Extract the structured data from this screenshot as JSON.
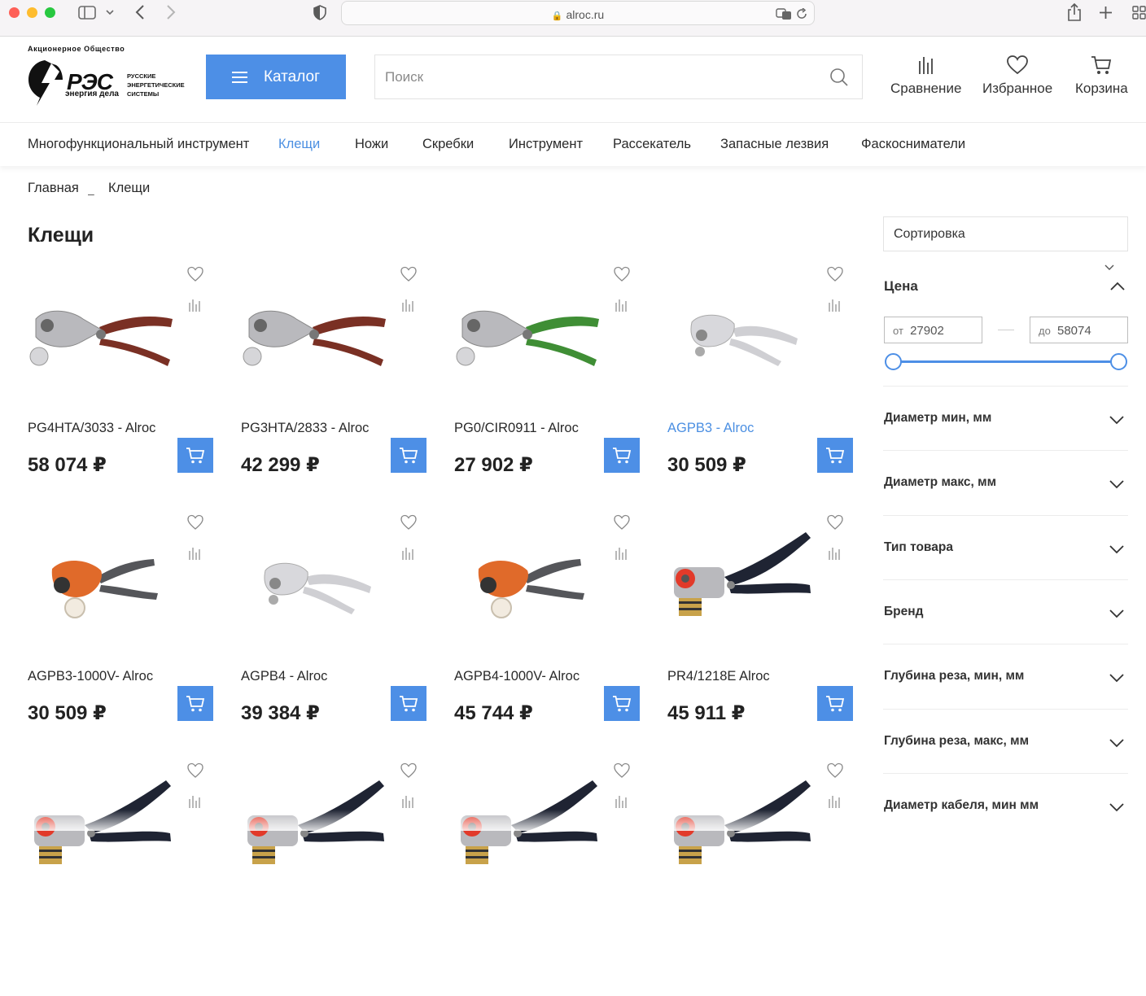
{
  "browser": {
    "url": "alroc.ru"
  },
  "logo": {
    "top_text": "Акционерное Общество",
    "name": "РЭС",
    "slogan": "энергия дела",
    "sub": [
      "РУССКИЕ",
      "ЭНЕРГЕТИЧЕСКИЕ",
      "СИСТЕМЫ"
    ]
  },
  "header": {
    "catalog_label": "Каталог",
    "search_placeholder": "Поиск",
    "compare_label": "Сравнение",
    "favorites_label": "Избранное",
    "cart_label": "Корзина"
  },
  "categories": [
    "Многофункциональный инструмент",
    "Клещи",
    "Ножи",
    "Скребки",
    "Инструмент",
    "Рассекатель",
    "Запасные лезвия",
    "Фаскосниматели"
  ],
  "active_category": "Клещи",
  "breadcrumb": [
    "Главная",
    "Клещи"
  ],
  "breadcrumb_sep": "–",
  "page_title": "Клещи",
  "products": [
    {
      "name": "PG4HTA/3033 - Alroc",
      "price": "58 074 ₽",
      "handle": "#7a3024",
      "head": "#b9b9bd",
      "highlighted": false
    },
    {
      "name": "PG3HTA/2833 - Alroc",
      "price": "42 299 ₽",
      "handle": "#7a3024",
      "head": "#b9b9bd",
      "highlighted": false
    },
    {
      "name": "PG0/CIR0911 - Alroc",
      "price": "27 902 ₽",
      "handle": "#3f8e35",
      "head": "#b9b9bd",
      "highlighted": false
    },
    {
      "name": "AGPB3 - Alroc",
      "price": "30 509 ₽",
      "handle": "#cfcfd3",
      "head": "#d8d8dc",
      "highlighted": true
    },
    {
      "name": "AGPB3-1000V- Alroc",
      "price": "30 509 ₽",
      "handle": "#55565a",
      "head": "#e06a2a",
      "highlighted": false
    },
    {
      "name": "AGPB4 - Alroc",
      "price": "39 384 ₽",
      "handle": "#cfcfd3",
      "head": "#d8d8dc",
      "highlighted": false
    },
    {
      "name": "AGPB4-1000V- Alroc",
      "price": "45 744 ₽",
      "handle": "#55565a",
      "head": "#e06a2a",
      "highlighted": false
    },
    {
      "name": "PR4/1218E Alroc",
      "price": "45 911 ₽",
      "handle": "#1f2433",
      "head": "#b9b9bd",
      "highlighted": false
    },
    {
      "name": "",
      "price": "",
      "handle": "#1f2433",
      "head": "#b9b9bd",
      "highlighted": false
    },
    {
      "name": "",
      "price": "",
      "handle": "#1f2433",
      "head": "#b9b9bd",
      "highlighted": false
    },
    {
      "name": "",
      "price": "",
      "handle": "#1f2433",
      "head": "#b9b9bd",
      "highlighted": false
    },
    {
      "name": "",
      "price": "",
      "handle": "#1f2433",
      "head": "#b9b9bd",
      "highlighted": false
    }
  ],
  "sidebar": {
    "sort_label": "Сортировка",
    "price_label": "Цена",
    "price_from_label": "от",
    "price_from": "27902",
    "price_to_label": "до",
    "price_to": "58074",
    "filters": [
      "Диаметр мин, мм",
      "Диаметр макс, мм",
      "Тип товара",
      "Бренд",
      "Глубина реза, мин, мм",
      "Глубина реза, макс, мм",
      "Диаметр кабеля, мин мм"
    ]
  },
  "colors": {
    "accent": "#4d8fe6",
    "link_active": "#4b8fe2"
  }
}
